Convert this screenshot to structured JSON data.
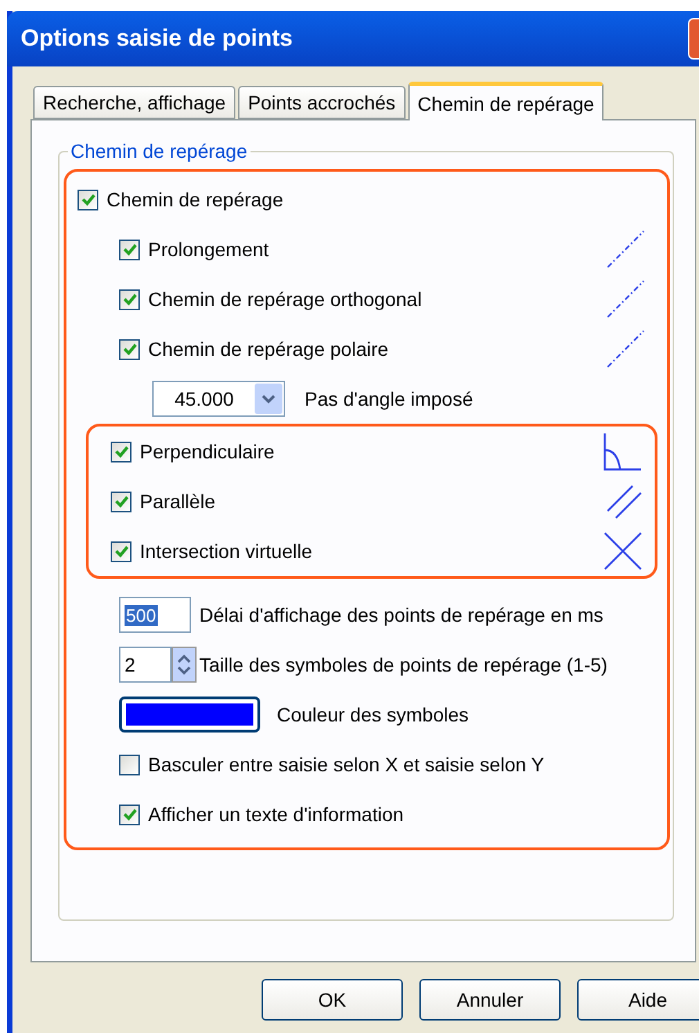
{
  "window": {
    "title": "Options saisie de points"
  },
  "tabs": [
    {
      "label": "Recherche, affichage",
      "selected": false
    },
    {
      "label": "Points accrochés",
      "selected": false
    },
    {
      "label": "Chemin de repérage",
      "selected": true
    }
  ],
  "group": {
    "title": "Chemin de repérage"
  },
  "tracking": {
    "label": "Chemin de repérage",
    "checked": true
  },
  "paths": [
    {
      "label": "Prolongement",
      "checked": true,
      "kind": "dashed"
    },
    {
      "label": "Chemin de repérage orthogonal",
      "checked": true,
      "kind": "dashed"
    },
    {
      "label": "Chemin de repérage polaire",
      "checked": true,
      "kind": "dashed"
    }
  ],
  "angle": {
    "value": "45.000",
    "label": "Pas d'angle imposé"
  },
  "snaps": [
    {
      "label": "Perpendiculaire",
      "checked": true,
      "kind": "perpendicular"
    },
    {
      "label": "Parallèle",
      "checked": true,
      "kind": "parallel"
    },
    {
      "label": "Intersection virtuelle",
      "checked": true,
      "kind": "cross"
    }
  ],
  "delay": {
    "value": "500",
    "label": "Délai d'affichage des points de repérage en ms"
  },
  "size": {
    "value": "2",
    "label": "Taille des symboles de points de repérage (1-5)"
  },
  "symbol_color": {
    "color": "#0000ff",
    "label": "Couleur des symboles"
  },
  "options": [
    {
      "label": "Basculer entre saisie selon X et saisie selon Y",
      "checked": false
    },
    {
      "label": "Afficher un texte d'information",
      "checked": true
    }
  ],
  "buttons": [
    "OK",
    "Annuler",
    "Aide"
  ]
}
